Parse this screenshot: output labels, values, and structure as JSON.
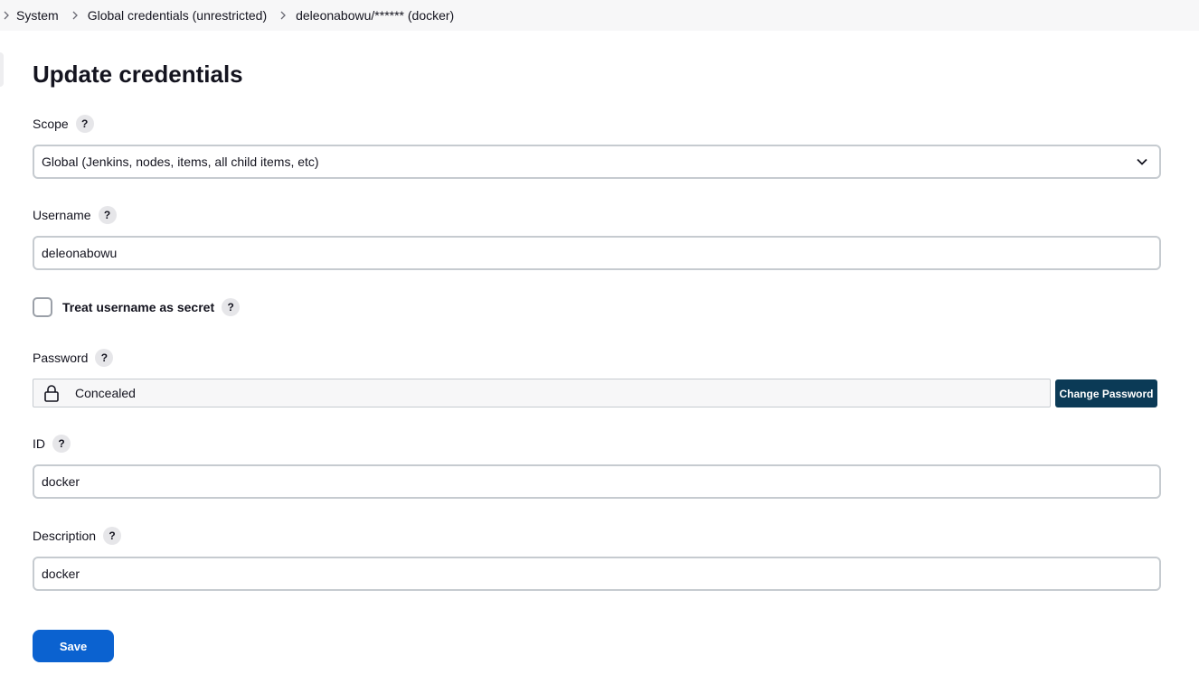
{
  "breadcrumb": [
    {
      "label": "System"
    },
    {
      "label": "Global credentials (unrestricted)"
    },
    {
      "label": "deleonabowu/****** (docker)"
    }
  ],
  "page": {
    "title": "Update credentials"
  },
  "help_glyph": "?",
  "form": {
    "scope": {
      "label": "Scope",
      "value": "Global (Jenkins, nodes, items, all child items, etc)"
    },
    "username": {
      "label": "Username",
      "value": "deleonabowu"
    },
    "treat_secret": {
      "label": "Treat username as secret",
      "checked": false
    },
    "password": {
      "label": "Password",
      "concealed_text": "Concealed",
      "change_label": "Change Password"
    },
    "id": {
      "label": "ID",
      "value": "docker"
    },
    "description": {
      "label": "Description",
      "value": "docker"
    }
  },
  "actions": {
    "save_label": "Save"
  },
  "colors": {
    "primary": "#0b62d0",
    "dark_button": "#0b3a56",
    "border": "#c6cbd0",
    "breadcrumb_bg": "#f7f7f8"
  },
  "icons": [
    "chevron-right-icon",
    "chevron-down-icon",
    "lock-icon",
    "help-icon"
  ]
}
